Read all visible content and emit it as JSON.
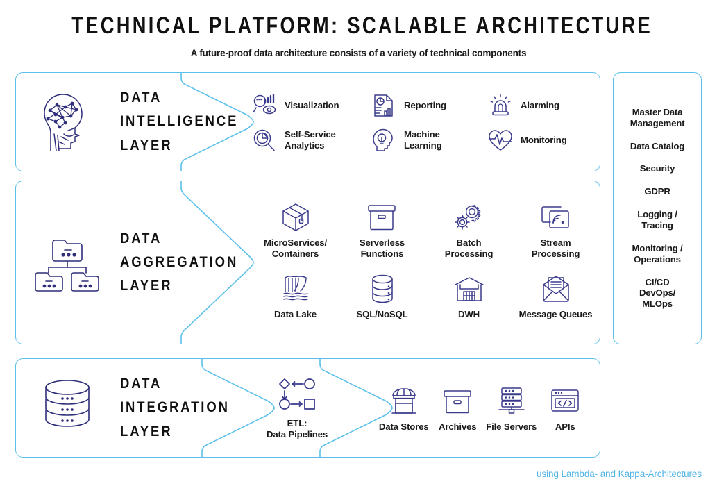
{
  "header": {
    "title": "TECHNICAL PLATFORM: SCALABLE ARCHITECTURE",
    "subtitle": "A future-proof data architecture consists of a variety of technical components"
  },
  "colors": {
    "panel_border": "#5bc0ea",
    "icon_stroke": "#3a3a8c",
    "title_text": "#111111",
    "footer_text": "#4fb3e5",
    "background": "#ffffff"
  },
  "layers": [
    {
      "id": "data-intelligence-layer",
      "title": "DATA\nINTELLIGENCE\nLAYER",
      "title_lines": [
        "DATA",
        "INTELLIGENCE",
        "LAYER"
      ],
      "icon": "head-brain-network-icon",
      "features": [
        {
          "label": "Visualization",
          "icon": "magnifier-chart-eye-icon"
        },
        {
          "label": "Reporting",
          "icon": "report-document-chart-icon"
        },
        {
          "label": "Alarming",
          "icon": "siren-alarm-icon"
        },
        {
          "label": "Self-Service\nAnalytics",
          "icon": "pie-chart-magnifier-icon"
        },
        {
          "label": "Machine\nLearning",
          "icon": "head-lightbulb-icon"
        },
        {
          "label": "Monitoring",
          "icon": "heart-pulse-icon"
        }
      ]
    },
    {
      "id": "data-aggregation-layer",
      "title": "DATA\nAGGREGATION\nLAYER",
      "title_lines": [
        "DATA",
        "AGGREGATION",
        "LAYER"
      ],
      "icon": "folder-hierarchy-icon",
      "features": [
        {
          "label": "MicroServices/\nContainers",
          "icon": "package-box-icon"
        },
        {
          "label": "Serverless\nFunctions",
          "icon": "storage-box-icon"
        },
        {
          "label": "Batch\nProcessing",
          "icon": "gears-icon"
        },
        {
          "label": "Stream\nProcessing",
          "icon": "stream-cast-icon"
        },
        {
          "label": "Data Lake",
          "icon": "waterfall-icon"
        },
        {
          "label": "SQL/NoSQL",
          "icon": "database-cylinder-icon"
        },
        {
          "label": "DWH",
          "icon": "warehouse-icon"
        },
        {
          "label": "Message Queues",
          "icon": "envelope-message-icon"
        }
      ]
    },
    {
      "id": "data-integration-layer",
      "title": "DATA\nINTEGRATION\nLAYER",
      "title_lines": [
        "DATA",
        "INTEGRATION",
        "LAYER"
      ],
      "icon": "stacked-database-icon",
      "etl": {
        "label": "ETL:\nData Pipelines",
        "icon": "etl-flow-diagram-icon"
      },
      "features": [
        {
          "label": "Data Stores",
          "icon": "storefront-icon"
        },
        {
          "label": "Archives",
          "icon": "archive-box-icon"
        },
        {
          "label": "File Servers",
          "icon": "server-rack-icon"
        },
        {
          "label": "APIs",
          "icon": "api-code-window-icon"
        }
      ]
    }
  ],
  "sidebar": {
    "items": [
      {
        "label": "Master Data\nManagement"
      },
      {
        "label": "Data Catalog"
      },
      {
        "label": "Security"
      },
      {
        "label": "GDPR"
      },
      {
        "label": "Logging /\nTracing"
      },
      {
        "label": "Monitoring /\nOperations"
      },
      {
        "label": "CI/CD\nDevOps/\nMLOps"
      }
    ]
  },
  "footer": {
    "note": "using Lambda- and Kappa-Architectures"
  }
}
